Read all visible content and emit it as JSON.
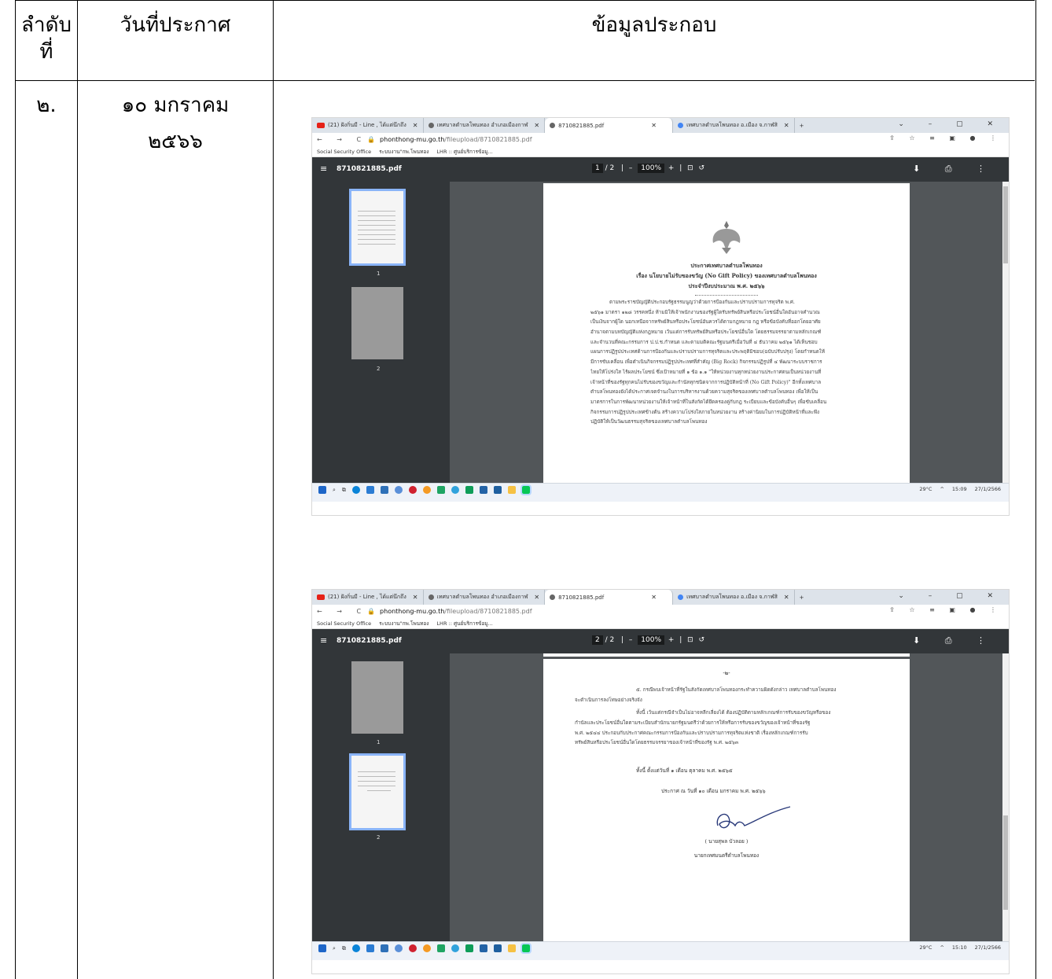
{
  "table": {
    "headers": {
      "no": "ลำดับ\nที่",
      "no_line1": "ลำดับ",
      "no_line2": "ที่",
      "date": "วันที่ประกาศ",
      "info": "ข้อมูลประกอบ"
    },
    "row": {
      "no": "๒.",
      "date_line1": "๑๐ มกราคม",
      "date_line2": "๒๕๖๖"
    }
  },
  "screenshots": [
    {
      "tabs": [
        "(21) ฝังกิ่นมี - Line , ได้แต่นึกถึง",
        "เทศบาลตำบลโพนทอง อำเภอเมืองกาฬ",
        "8710821885.pdf",
        "เทศบาลตำบลโพนทอง อ.เมือง จ.กาฬสิ"
      ],
      "url_host": "phonthong-mu.go.th",
      "url_path": "/fileupload/8710821885.pdf",
      "bookmarks": [
        "Social Security Office",
        "ระบบงาน\"กพ.โพนทอง",
        "LHR :: ศูนย์บริการข้อมู..."
      ],
      "file_name": "8710821885.pdf",
      "page_current": "1",
      "page_total": "/ 2",
      "zoom": "100%",
      "thumb_labels": [
        "1",
        "2"
      ],
      "doc_heading_1": "ประกาศเทศบาลตำบลโพนทอง",
      "doc_heading_2": "เรื่อง นโยบายไม่รับของขวัญ (No Gift Policy) ของเทศบาลตำบลโพนทอง",
      "doc_heading_3": "ประจำปีงบประมาณ พ.ศ. ๒๕๖๖",
      "doc_body": [
        "ตามพระราชบัญญัติประกอบรัฐธรรมนูญว่าด้วยการป้องกันและปราบปรามการทุจริต พ.ศ.",
        "๒๕๖๑ มาตรา ๑๒๘ วรรคหนึ่ง ห้ามมิให้เจ้าพนักงานของรัฐผู้ใดรับทรัพย์สินหรือประโยชน์อื่นใดอันอาจคำนวณ",
        "เป็นเงินจากผู้ใด นอกเหนือจากทรัพย์สินหรือประโยชน์อันควรได้ตามกฎหมาย กฎ หรือข้อบังคับที่ออกโดยอาศัย",
        "อำนาจตามบทบัญญัติแห่งกฎหมาย เว้นแต่การรับทรัพย์สินหรือประโยชน์อื่นใด โดยธรรมจรรยาตามหลักเกณฑ์",
        "และจำนวนที่คณะกรรมการ ป.ป.ช.กำหนด และตามมติคณะรัฐมนตรีเมื่อวันที่ ๔ ธันวาคม ๒๕๖๑ ได้เห็นชอบ",
        "แผนการปฏิรูปประเทศด้านการป้องกันและปราบปรามการทุจริตและประพฤติมิชอบ(ฉบับปรับปรุง) โดยกำหนดให้",
        "มีการขับเคลื่อน เพื่อดำเนินกิจกรรมปฏิรูปประเทศที่สำคัญ (Big Rock) กิจกรรมปฏิรูปที่ ๔ พัฒนาระบบราชการ",
        "ไทยให้โปร่งใส ไร้ผลประโยชน์ ซึ่งเป้าหมายที่ ๑ ข้อ ๑.๑ \"ให้หน่วยงานทุกหน่วยงานประกาศตนเป็นหน่วยงานที่",
        "เจ้าหน้าที่ของรัฐทุกคนไม่รับของขวัญและกำนัลทุกชนิดจากการปฏิบัติหน้าที่ (No Gift Policy)\" อีกทั้งเทศบาล",
        "ตำบลโพนทองยังได้ประกาศเจตจำนงในการบริหารงานด้วยความสุจริตของเทศบาลตำบลโพนทอง เพื่อให้เป็น",
        "มาตรการในการพัฒนาหน่วยงานให้เจ้าหน้าที่ในสังกัดได้ยึดครองคู่กับกฎ ระเบียบและข้อบังคับอื่นๆ เพื่อขับเคลื่อน",
        "กิจกรรมการปฏิรูปประเทศข้างต้น สร้างความโปร่งใสภายในหน่วยงาน สร้างค่านิยมในการปฏิบัติหน้าที่และพึง",
        "ปฏิบัติให้เป็นวัฒนธรรมสุจริตของเทศบาลตำบลโพนทอง"
      ],
      "clock_time": "15:09",
      "clock_date": "27/1/2566",
      "temp": "29°C"
    },
    {
      "tabs": [
        "(21) ฝังกิ่นมี - Line , ได้แต่นึกถึง",
        "เทศบาลตำบลโพนทอง อำเภอเมืองกาฬ",
        "8710821885.pdf",
        "เทศบาลตำบลโพนทอง อ.เมือง จ.กาฬสิ"
      ],
      "url_host": "phonthong-mu.go.th",
      "url_path": "/fileupload/8710821885.pdf",
      "bookmarks": [
        "Social Security Office",
        "ระบบงาน\"กพ.โพนทอง",
        "LHR :: ศูนย์บริการข้อมู..."
      ],
      "file_name": "8710821885.pdf",
      "page_current": "2",
      "page_total": "/ 2",
      "zoom": "100%",
      "thumb_labels": [
        "1",
        "2"
      ],
      "page_marker": "-๒-",
      "doc_body": [
        "๕. กรณีพบเจ้าหน้าที่รัฐในสังกัดเทศบาลโพนทองกระทำความผิดดังกล่าว เทศบาลตำบลโพนทอง",
        "จะดำเนินการลงโทษอย่างจริงจัง",
        "ทั้งนี้ เว้นแต่กรณีจำเป็นไม่อาจหลีกเลี่ยงได้ ต้องปฏิบัติตามหลักเกณฑ์การรับของขวัญหรือของ",
        "กำนัลและประโยชน์อื่นใดตามระเบียบสำนักนายกรัฐมนตรีว่าด้วยการให้หรือการรับของขวัญของเจ้าหน้าที่ของรัฐ",
        "พ.ศ. ๒๕๔๔ ประกอบกับประกาศคณะกรรมการป้องกันและปราบปรามการทุจริตแห่งชาติ เรื่องหลักเกณฑ์การรับ",
        "ทรัพย์สินหรือประโยชน์อื่นใดโดยธรรมจรรยาของเจ้าหน้าที่ของรัฐ พ.ศ. ๒๕๖๓"
      ],
      "effective": "ทั้งนี้ ตั้งแต่วันที่ ๑ เดือน ตุลาคม พ.ศ. ๒๕๖๕",
      "announced": "ประกาศ ณ วันที่ ๑๐ เดือน มกราคม พ.ศ. ๒๕๖๖",
      "signer": "( นายสุพล บัวลอย )",
      "signer_title": "นายกเทศมนตรีตำบลโพนทอง",
      "clock_time": "15:10",
      "clock_date": "27/1/2566",
      "temp": "29°C"
    }
  ]
}
